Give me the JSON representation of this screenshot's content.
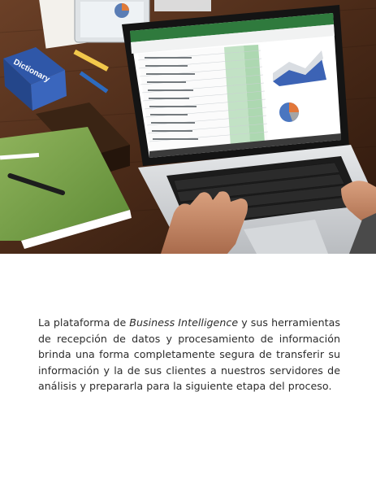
{
  "photo": {
    "book_spine_text": "Dictionary"
  },
  "caption": {
    "before_italic": "La plataforma de ",
    "italic": "Business Intelligence",
    "after_italic": " y sus herramientas de recepción de datos y procesamiento de información brinda una forma completamente segura de transferir su información y la de sus clientes a nuestros servidores de análisis y prepararla para la siguiente etapa del proceso."
  }
}
